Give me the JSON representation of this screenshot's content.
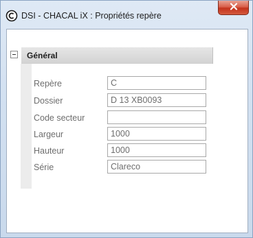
{
  "window": {
    "title": "DSI - CHACAL iX : Propriétés repère"
  },
  "icons": {
    "app": "app-circle-c-icon",
    "close": "close-x-icon",
    "expander": "collapse-minus-icon"
  },
  "colors": {
    "close_button": "#c3331c",
    "section_bar": "#d6d6d6",
    "label_text": "#6e6e6e"
  },
  "section": {
    "title": "Général",
    "expanded": true
  },
  "properties": [
    {
      "label": "Repère",
      "value": "C"
    },
    {
      "label": "Dossier",
      "value": "D 13 XB0093"
    },
    {
      "label": "Code secteur",
      "value": ""
    },
    {
      "label": "Largeur",
      "value": "1000"
    },
    {
      "label": "Hauteur",
      "value": "1000"
    },
    {
      "label": "Série",
      "value": "Clareco"
    }
  ]
}
